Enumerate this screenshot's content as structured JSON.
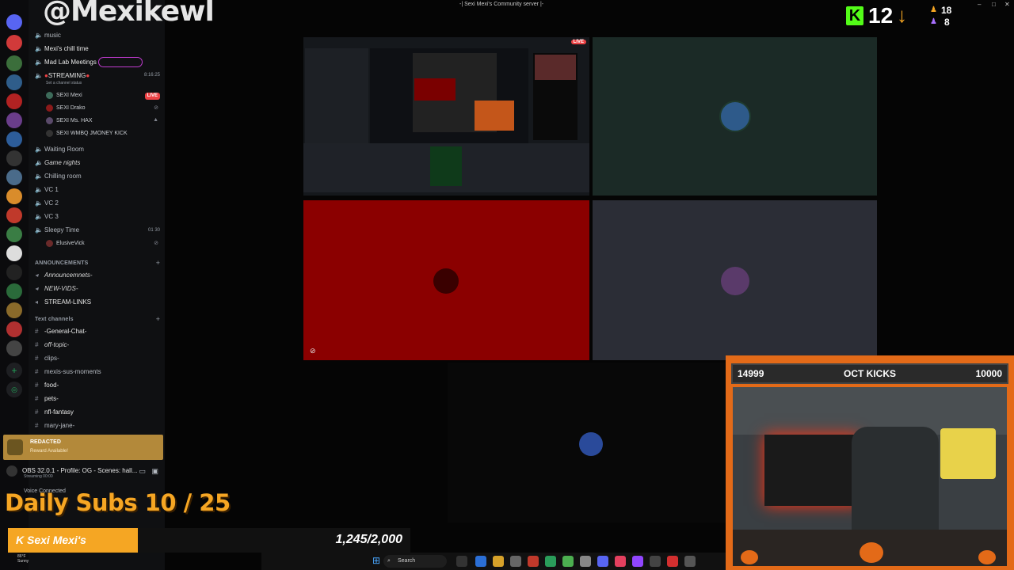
{
  "overlay": {
    "watermark": "@Mexikewl",
    "daily_subs": "Daily Subs 10 / 25",
    "progress_label": "Sexi Mexi's",
    "progress_value": "1,245/2,000",
    "progress_fraction": 0.6225,
    "kick_count": "12",
    "viewer_top": "18",
    "viewer_bottom": "8",
    "weather_temp": "86°F",
    "weather_desc": "Sunny"
  },
  "window": {
    "title": "-| Sexi Mexi's Community server |-"
  },
  "sidebar": {
    "voice_channels": [
      {
        "label": "music"
      },
      {
        "label": "Mexi's chill time"
      },
      {
        "label": "Mad Lab Meetings"
      },
      {
        "label": "STREAMING",
        "timer": "8:16:25",
        "status": "Set a channel status"
      }
    ],
    "streaming_members": [
      {
        "label": "SEXI Mexi",
        "badge": "LIVE"
      },
      {
        "label": "SEXI Drako"
      },
      {
        "label": "SEXI Ms. HAX"
      },
      {
        "label": "SEXI WMBQ JMONEY KICK"
      }
    ],
    "more_voice": [
      {
        "label": "Waiting Room"
      },
      {
        "label": "Game nights"
      },
      {
        "label": "Chilling room"
      },
      {
        "label": "VC 1"
      },
      {
        "label": "VC 2"
      },
      {
        "label": "VC 3"
      },
      {
        "label": "Sleepy Time",
        "count": "01 30"
      }
    ],
    "sleepy_member": "ElusiveVick",
    "announcements_category": "ANNOUNCEMENTS",
    "announcement_channels": [
      {
        "label": "Announcemnets-"
      },
      {
        "label": "NEW-VIDS-"
      },
      {
        "label": "STREAM-LINKS"
      }
    ],
    "text_category": "Text channels",
    "text_channels": [
      {
        "label": "-General-Chat-"
      },
      {
        "label": "off-topic-"
      },
      {
        "label": "clips-"
      },
      {
        "label": "mexis-sus-moments"
      },
      {
        "label": "food-"
      },
      {
        "label": "pets-"
      },
      {
        "label": "nfl-fantasy"
      },
      {
        "label": "mary-jane-"
      }
    ],
    "reward_title": "REDACTED",
    "reward_sub": "Reward Available!",
    "obs_status": "OBS 32.0.1 - Profile: OG - Scenes: hall...",
    "obs_sub": "Streaming 00:00",
    "voice_connected": "Voice Connected"
  },
  "webcam": {
    "left_count": "14999",
    "title": "OCT KICKS",
    "right_count": "10000"
  },
  "taskbar": {
    "search_label": "Search"
  },
  "colors": {
    "accent_orange": "#f5a623",
    "kick_green": "#53fc18",
    "live_red": "#ed4245",
    "red_tile": "#8b0000",
    "green_tile": "#1b2a26",
    "gray_tile": "#2b2d36"
  }
}
